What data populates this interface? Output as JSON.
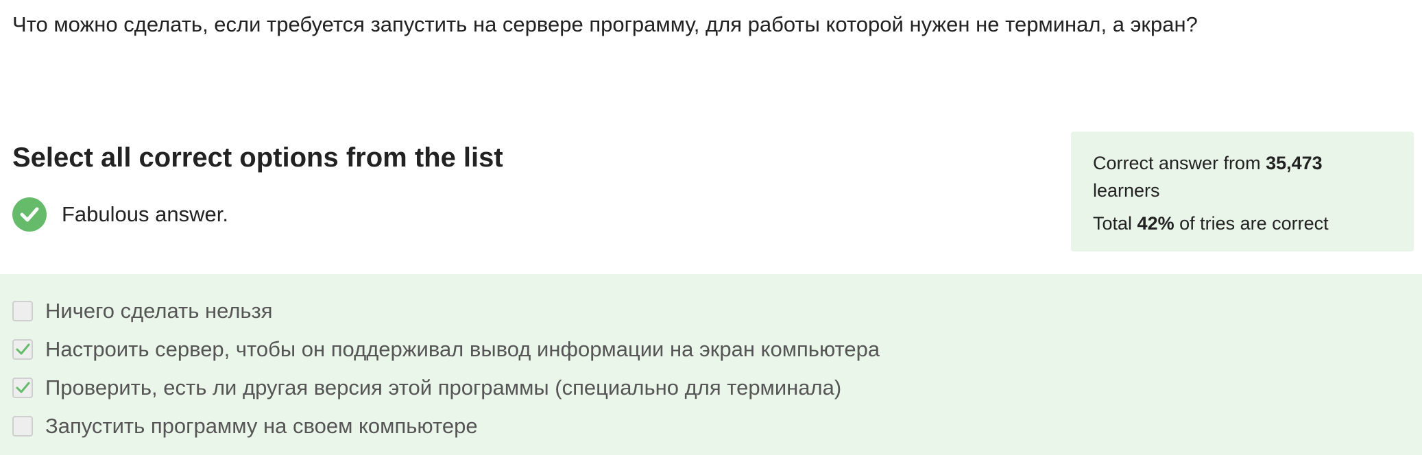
{
  "question": {
    "text": "Что можно сделать, если требуется запустить на сервере программу, для работы которой нужен не терминал, а экран?"
  },
  "instruction": "Select all correct options from the list",
  "feedback": {
    "icon": "check-circle-icon",
    "text": "Fabulous answer.",
    "color": "#66bb6a"
  },
  "stats": {
    "line1_prefix": "Correct answer from ",
    "learners_count": "35,473",
    "line1_suffix": " learners",
    "line2_prefix": "Total ",
    "percent": "42%",
    "line2_suffix": " of tries are correct",
    "background": "#e9f5e9"
  },
  "options": [
    {
      "label": "Ничего сделать нельзя",
      "checked": false
    },
    {
      "label": "Настроить сервер, чтобы он поддерживал вывод информации на экран компьютера",
      "checked": true
    },
    {
      "label": "Проверить, есть ли другая версия этой программы (специально для терминала)",
      "checked": true
    },
    {
      "label": "Запустить программу на своем компьютере",
      "checked": false
    }
  ],
  "colors": {
    "accent": "#66bb6a",
    "options_background": "#ebf6eb"
  }
}
